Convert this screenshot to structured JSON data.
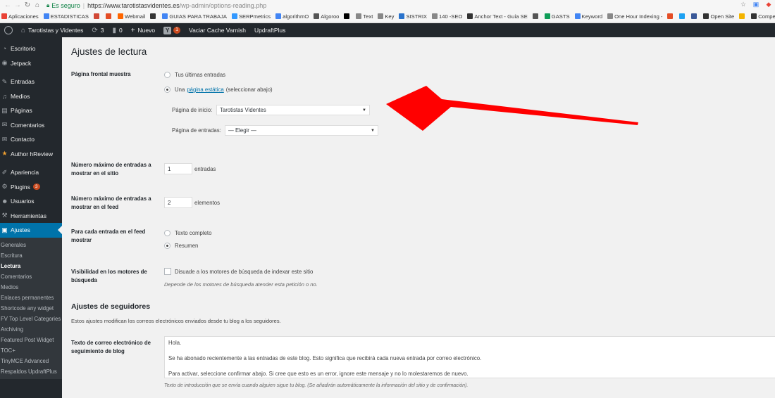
{
  "browser": {
    "back": "←",
    "forward": "→",
    "reload": "↻",
    "home": "⌂",
    "secure_label": "Es seguro",
    "url_main": "https://www.tarotistasvidentes.es",
    "url_rest": "/wp-admin/options-reading.php"
  },
  "bookmarks": [
    {
      "label": "Aplicaciones",
      "color": "#e94235"
    },
    {
      "label": "ESTADISTICAS",
      "color": "#4285f4"
    },
    {
      "label": "",
      "color": "#d14836"
    },
    {
      "label": "",
      "color": "#e44d26"
    },
    {
      "label": "Webmail",
      "color": "#ff6600"
    },
    {
      "label": "",
      "color": "#333333"
    },
    {
      "label": "GUIAS PARA TRABAJA",
      "color": "#4285f4"
    },
    {
      "label": "SERPmetrics",
      "color": "#3399ff"
    },
    {
      "label": "algorithmO",
      "color": "#4285f4"
    },
    {
      "label": "Algoroo",
      "color": "#555555"
    },
    {
      "label": "",
      "color": "#000000"
    },
    {
      "label": "Text",
      "color": "#888888"
    },
    {
      "label": "Key",
      "color": "#888888"
    },
    {
      "label": "SISTRIX",
      "color": "#2a73cc"
    },
    {
      "label": "140 -SEO",
      "color": "#888888"
    },
    {
      "label": "Anchor Text - Guía SE",
      "color": "#333333"
    },
    {
      "label": "",
      "color": "#555555"
    },
    {
      "label": "GASTS",
      "color": "#0f9d58"
    },
    {
      "label": "Keyword",
      "color": "#4285f4"
    },
    {
      "label": "One Hour Indexing -",
      "color": "#888888"
    },
    {
      "label": "",
      "color": "#e44d26"
    },
    {
      "label": "",
      "color": "#1da1f2"
    },
    {
      "label": "",
      "color": "#3b5998"
    },
    {
      "label": "Open Site",
      "color": "#333333"
    },
    {
      "label": "",
      "color": "#f4b400"
    },
    {
      "label": "Competitor",
      "color": "#333333"
    }
  ],
  "adminbar": {
    "site_name": "Tarotistas y Videntes",
    "updates_count": "3",
    "comments_count": "0",
    "new_label": "Nuevo",
    "yoast_count": "1",
    "varnish_label": "Vaciar Cache Varnish",
    "updraft_label": "UpdraftPlus"
  },
  "sidebar": {
    "items": [
      {
        "label": "Escritorio",
        "icon": "◔"
      },
      {
        "label": "Jetpack",
        "icon": "◉"
      },
      {
        "label": "Entradas",
        "icon": "✎"
      },
      {
        "label": "Medios",
        "icon": "♫"
      },
      {
        "label": "Páginas",
        "icon": "▤"
      },
      {
        "label": "Comentarios",
        "icon": "✉"
      },
      {
        "label": "Contacto",
        "icon": "✉"
      },
      {
        "label": "Author hReview",
        "icon": "★"
      },
      {
        "label": "Apariencia",
        "icon": "✐"
      },
      {
        "label": "Plugins",
        "icon": "⚙",
        "count": "3"
      },
      {
        "label": "Usuarios",
        "icon": "☻"
      },
      {
        "label": "Herramientas",
        "icon": "⚒"
      },
      {
        "label": "Ajustes",
        "icon": "▣"
      }
    ],
    "submenu": [
      "Generales",
      "Escritura",
      "Lectura",
      "Comentarios",
      "Medios",
      "Enlaces permanentes",
      "Shortcode any widget",
      "FV Top Level Categories",
      "Archiving",
      "Featured Post Widget",
      "TOC+",
      "TinyMCE Advanced",
      "Respaldos UpdraftPlus"
    ]
  },
  "main": {
    "title": "Ajustes de lectura",
    "front_page": {
      "label": "Página frontal muestra",
      "option_latest": "Tus últimas entradas",
      "option_static_prefix": "Una",
      "option_static_link": "página estática",
      "option_static_suffix": "(seleccionar abajo)",
      "home_label": "Página de inicio:",
      "home_value": "Tarotistas Videntes",
      "posts_label": "Página de entradas:",
      "posts_value": "— Elegir —"
    },
    "posts_per_page": {
      "label": "Número máximo de entradas a mostrar en el sitio",
      "value": "1",
      "suffix": "entradas"
    },
    "posts_per_rss": {
      "label": "Número máximo de entradas a mostrar en el feed",
      "value": "2",
      "suffix": "elementos"
    },
    "feed_content": {
      "label": "Para cada entrada en el feed mostrar",
      "option_full": "Texto completo",
      "option_summary": "Resumen"
    },
    "visibility": {
      "label": "Visibilidad en los motores de búsqueda",
      "checkbox": "Disuade a los motores de búsqueda de indexar este sitio",
      "description": "Depende de los motores de búsqueda atender esta petición o no."
    },
    "subscribers": {
      "heading": "Ajustes de seguidores",
      "description": "Estos ajustes modifican los correos electrónicos enviados desde tu blog a los seguidores.",
      "email_label": "Texto de correo electrónico de seguimiento de blog",
      "email_line1": "Hola.",
      "email_line2": "Se ha abonado recientemente a las entradas de este blog. Esto significa que recibirá cada nueva entrada por correo electrónico.",
      "email_line3": "Para activar, seleccione confirmar abajo. Si cree que esto es un error, ignore este mensaje y no lo molestaremos de nuevo.",
      "email_help": "Texto de introducción que se envía cuando alguien sigue tu blog. (Se añadirán automáticamente la información del sitio y de confirmación)."
    }
  },
  "colors": {
    "admin_dark": "#23282d",
    "accent": "#0073aa",
    "arrow": "#ff0000",
    "badge": "#ca4a1f"
  }
}
